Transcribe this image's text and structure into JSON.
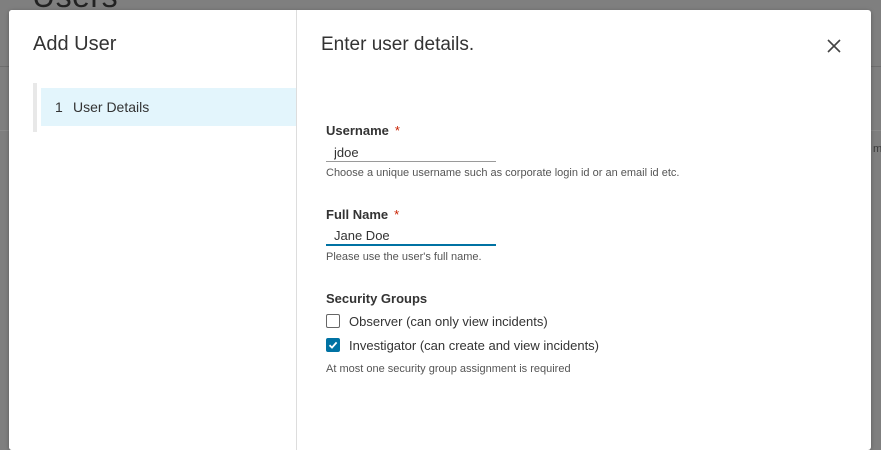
{
  "background": {
    "page_title": "Users",
    "edge_text": "m"
  },
  "modal": {
    "title": "Add User",
    "steps": [
      {
        "number": "1",
        "label": "User Details"
      }
    ]
  },
  "content": {
    "title": "Enter user details.",
    "close_icon": "close-icon",
    "username": {
      "label": "Username",
      "required_mark": "*",
      "value": "jdoe",
      "help": "Choose a unique username such as corporate login id or an email id etc."
    },
    "full_name": {
      "label": "Full Name",
      "required_mark": "*",
      "value": "Jane Doe",
      "help": "Please use the user's full name."
    },
    "security_groups": {
      "label": "Security Groups",
      "options": [
        {
          "label": "Observer (can only view incidents)",
          "checked": false
        },
        {
          "label": "Investigator (can create and view incidents)",
          "checked": true
        }
      ],
      "help": "At most one security group assignment is required"
    }
  },
  "colors": {
    "accent": "#0072a3",
    "step_active_bg": "#e3f5fc",
    "required": "#c92100",
    "overlay": "#7f7f7f"
  }
}
